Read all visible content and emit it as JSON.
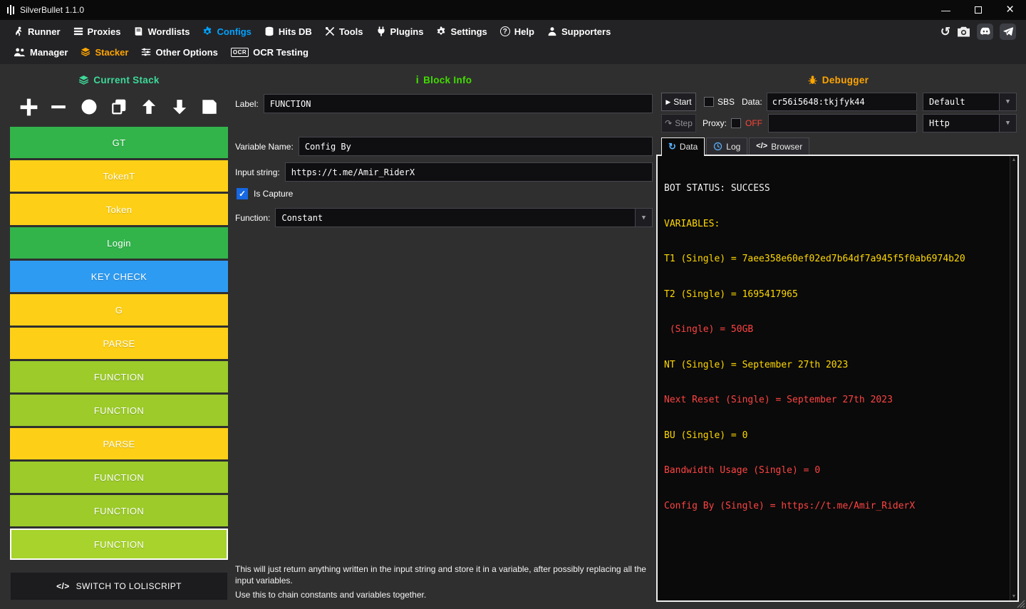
{
  "window": {
    "title": "SilverBullet 1.1.0"
  },
  "icons": {
    "minimize": "—",
    "close": "×",
    "history": "↺",
    "check": "✓",
    "dropdown_arrow": "▼",
    "start_play": "▶",
    "step_arrow": "↷",
    "data_refresh": "↻",
    "code": "</>",
    "info": "i",
    "help": "?",
    "ocr": "OCR"
  },
  "menubar": {
    "items": [
      {
        "label": "Runner"
      },
      {
        "label": "Proxies"
      },
      {
        "label": "Wordlists"
      },
      {
        "label": "Configs",
        "active": true
      },
      {
        "label": "Hits DB"
      },
      {
        "label": "Tools"
      },
      {
        "label": "Plugins"
      },
      {
        "label": "Settings"
      },
      {
        "label": "Help"
      },
      {
        "label": "Supporters"
      }
    ]
  },
  "submenu": {
    "items": [
      {
        "label": "Manager"
      },
      {
        "label": "Stacker",
        "active": true
      },
      {
        "label": "Other Options"
      },
      {
        "label": "OCR Testing"
      }
    ]
  },
  "stack": {
    "header": "Current Stack",
    "blocks": [
      {
        "label": "GT",
        "color": "#32b44a"
      },
      {
        "label": "TokenT",
        "color": "#fdd017"
      },
      {
        "label": "Token",
        "color": "#fdd017"
      },
      {
        "label": "Login",
        "color": "#32b44a"
      },
      {
        "label": "KEY CHECK",
        "color": "#2e9bf2"
      },
      {
        "label": "G",
        "color": "#fdd017"
      },
      {
        "label": "PARSE",
        "color": "#fdd017"
      },
      {
        "label": "FUNCTION",
        "color": "#9ccb2a"
      },
      {
        "label": "FUNCTION",
        "color": "#9ccb2a"
      },
      {
        "label": "PARSE",
        "color": "#fdd017"
      },
      {
        "label": "FUNCTION",
        "color": "#9ccb2a"
      },
      {
        "label": "FUNCTION",
        "color": "#9ccb2a"
      },
      {
        "label": "FUNCTION",
        "color": "#a7d32c",
        "selected": true
      }
    ],
    "switch_button": "SWITCH TO LOLISCRIPT"
  },
  "block_info": {
    "header": "Block Info",
    "label_field": {
      "name": "Label:",
      "value": "FUNCTION"
    },
    "variable_name": {
      "name": "Variable Name:",
      "value": "Config By"
    },
    "input_string": {
      "name": "Input string:",
      "value": "https://t.me/Amir_RiderX"
    },
    "is_capture": "Is Capture",
    "function": {
      "name": "Function:",
      "value": "Constant"
    },
    "description_1": "This will just return anything written in the input string and store it in a variable, after possibly replacing all the input variables.",
    "description_2": "Use this to chain constants and variables together."
  },
  "debugger": {
    "header": "Debugger",
    "start": "Start",
    "step": "Step",
    "sbs": "SBS",
    "data_label": "Data:",
    "data_value": "cr56i5648:tkjfyk44",
    "wordlist_type": "Default",
    "proxy_label": "Proxy:",
    "proxy_off": "OFF",
    "proxy_value": "",
    "proxy_type": "Http",
    "tabs": [
      {
        "label": "Data"
      },
      {
        "label": "Log"
      },
      {
        "label": "Browser"
      }
    ],
    "console": [
      {
        "text": "BOT STATUS: SUCCESS",
        "color": "#f2f2f2"
      },
      {
        "text": "VARIABLES:",
        "color": "#ffd800"
      },
      {
        "text": "T1 (Single) = 7aee358e60ef02ed7b64df7a945f5f0ab6974b20",
        "color": "#ffd800"
      },
      {
        "text": "T2 (Single) = 1695417965",
        "color": "#ffd800"
      },
      {
        "text": " (Single) = 50GB",
        "color": "#ff4343"
      },
      {
        "text": "NT (Single) = September 27th 2023",
        "color": "#ffd800"
      },
      {
        "text": "Next Reset (Single) = September 27th 2023",
        "color": "#ff4343"
      },
      {
        "text": "BU (Single) = 0",
        "color": "#ffd800"
      },
      {
        "text": "Bandwidth Usage (Single) = 0",
        "color": "#ff4343"
      },
      {
        "text": "Config By (Single) = https://t.me/Amir_RiderX",
        "color": "#ff4343"
      }
    ]
  },
  "colors": {
    "accent_blue": "#00a2ff",
    "accent_orange": "#ffa500",
    "stack_header_green": "#3ed998",
    "block_info_green": "#42dc00",
    "capture_red": "#ff4343",
    "variable_yellow": "#ffd800"
  }
}
